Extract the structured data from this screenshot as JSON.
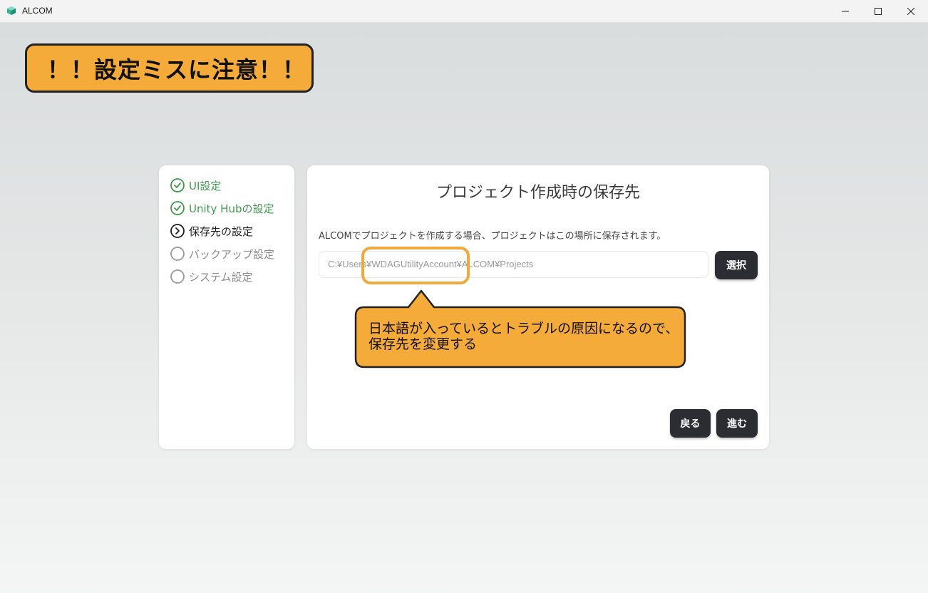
{
  "window": {
    "title": "ALCOM",
    "icon": "alcom-cube-icon",
    "controls": {
      "minimize": "minimize-icon",
      "maximize": "maximize-icon",
      "close": "close-icon"
    }
  },
  "annotation": {
    "banner": "！！設定ミスに注意！！",
    "callout_line1": "日本語が入っているとトラブルの原因になるので、",
    "callout_line2": "保存先を変更する",
    "accent_color": "#f4ab39"
  },
  "steps": [
    {
      "label": "UI設定",
      "status": "done"
    },
    {
      "label": "Unity Hubの設定",
      "status": "done"
    },
    {
      "label": "保存先の設定",
      "status": "current"
    },
    {
      "label": "バックアップ設定",
      "status": "pending"
    },
    {
      "label": "システム設定",
      "status": "pending"
    }
  ],
  "main": {
    "title": "プロジェクト作成時の保存先",
    "description": "ALCOMでプロジェクトを作成する場合、プロジェクトはこの場所に保存されます。",
    "path_value": "C:¥Users¥WDAGUtilityAccount¥ALCOM¥Projects",
    "select_label": "選択",
    "back_label": "戻る",
    "next_label": "進む"
  },
  "colors": {
    "done": "#3f9a4e",
    "button": "#2b2d33"
  }
}
